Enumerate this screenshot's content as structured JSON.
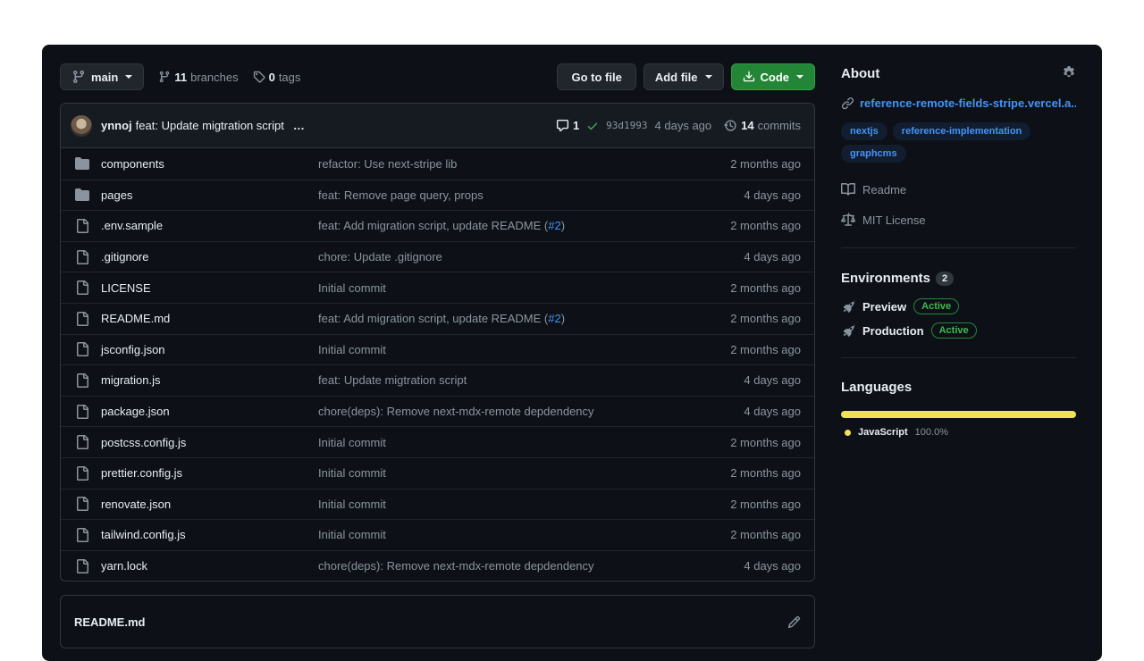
{
  "toolbar": {
    "branch": "main",
    "branches_count": "11",
    "branches_label": "branches",
    "tags_count": "0",
    "tags_label": "tags",
    "go_to_file": "Go to file",
    "add_file": "Add file",
    "code": "Code"
  },
  "commit": {
    "user": "ynnoj",
    "message": "feat: Update migtration script",
    "ellipsis": "…",
    "comments": "1",
    "sha": "93d1993",
    "time": "4 days ago",
    "commits_count": "14",
    "commits_label": "commits"
  },
  "files": [
    {
      "type": "dir",
      "name": "components",
      "message": "refactor: Use next-stripe lib",
      "pr": "",
      "pr_suffix": "",
      "date": "2 months ago"
    },
    {
      "type": "dir",
      "name": "pages",
      "message": "feat: Remove page query, props",
      "pr": "",
      "pr_suffix": "",
      "date": "4 days ago"
    },
    {
      "type": "file",
      "name": ".env.sample",
      "message": "feat: Add migration script, update README (",
      "pr": "#2",
      "pr_suffix": ")",
      "date": "2 months ago"
    },
    {
      "type": "file",
      "name": ".gitignore",
      "message": "chore: Update .gitignore",
      "pr": "",
      "pr_suffix": "",
      "date": "4 days ago"
    },
    {
      "type": "file",
      "name": "LICENSE",
      "message": "Initial commit",
      "pr": "",
      "pr_suffix": "",
      "date": "2 months ago"
    },
    {
      "type": "file",
      "name": "README.md",
      "message": "feat: Add migration script, update README (",
      "pr": "#2",
      "pr_suffix": ")",
      "date": "2 months ago"
    },
    {
      "type": "file",
      "name": "jsconfig.json",
      "message": "Initial commit",
      "pr": "",
      "pr_suffix": "",
      "date": "2 months ago"
    },
    {
      "type": "file",
      "name": "migration.js",
      "message": "feat: Update migtration script",
      "pr": "",
      "pr_suffix": "",
      "date": "4 days ago"
    },
    {
      "type": "file",
      "name": "package.json",
      "message": "chore(deps): Remove next-mdx-remote depdendency",
      "pr": "",
      "pr_suffix": "",
      "date": "4 days ago"
    },
    {
      "type": "file",
      "name": "postcss.config.js",
      "message": "Initial commit",
      "pr": "",
      "pr_suffix": "",
      "date": "2 months ago"
    },
    {
      "type": "file",
      "name": "prettier.config.js",
      "message": "Initial commit",
      "pr": "",
      "pr_suffix": "",
      "date": "2 months ago"
    },
    {
      "type": "file",
      "name": "renovate.json",
      "message": "Initial commit",
      "pr": "",
      "pr_suffix": "",
      "date": "2 months ago"
    },
    {
      "type": "file",
      "name": "tailwind.config.js",
      "message": "Initial commit",
      "pr": "",
      "pr_suffix": "",
      "date": "2 months ago"
    },
    {
      "type": "file",
      "name": "yarn.lock",
      "message": "chore(deps): Remove next-mdx-remote depdendency",
      "pr": "",
      "pr_suffix": "",
      "date": "4 days ago"
    }
  ],
  "readme": {
    "title": "README.md"
  },
  "about": {
    "title": "About",
    "link": "reference-remote-fields-stripe.vercel.a...",
    "topics": [
      "nextjs",
      "reference-implementation",
      "graphcms"
    ],
    "readme_label": "Readme",
    "license_label": "MIT License"
  },
  "environments": {
    "title": "Environments",
    "count": "2",
    "items": [
      {
        "name": "Preview",
        "status": "Active"
      },
      {
        "name": "Production",
        "status": "Active"
      }
    ]
  },
  "languages": {
    "title": "Languages",
    "items": [
      {
        "name": "JavaScript",
        "percent": "100.0%",
        "fraction": 1.0,
        "color": "#f1e05a"
      }
    ]
  }
}
